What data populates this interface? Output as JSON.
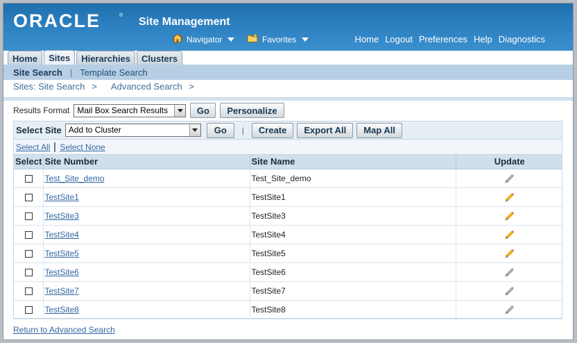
{
  "header": {
    "logo_text": "ORACLE",
    "logo_reg": "®",
    "app_title": "Site Management",
    "navigator_label": "Navigator",
    "favorites_label": "Favorites",
    "global_links": [
      "Home",
      "Logout",
      "Preferences",
      "Help",
      "Diagnostics"
    ]
  },
  "tabs": [
    {
      "label": "Home",
      "active": false
    },
    {
      "label": "Sites",
      "active": true
    },
    {
      "label": "Hierarchies",
      "active": false
    },
    {
      "label": "Clusters",
      "active": false
    }
  ],
  "subtabs": {
    "active": "Site Search",
    "separator": "|",
    "other": "Template Search"
  },
  "breadcrumb": {
    "items": [
      "Sites: Site Search",
      "Advanced Search"
    ],
    "arrow": ">"
  },
  "results_format": {
    "label": "Results Format",
    "selected": "Mail Box Search Results",
    "go_label": "Go",
    "personalize_label": "Personalize"
  },
  "control_bar": {
    "select_site_label": "Select Site",
    "selected_action": "Add to Cluster",
    "go_label": "Go",
    "separator": "|",
    "create_label": "Create",
    "export_label": "Export All",
    "map_label": "Map All"
  },
  "select_links": {
    "select_all": "Select All",
    "select_none": "Select None"
  },
  "table": {
    "columns": [
      "Select",
      "Site Number",
      "Site Name",
      "Update"
    ],
    "rows": [
      {
        "number": "Test_Site_demo",
        "name": "Test_Site_demo",
        "updatable": false
      },
      {
        "number": "TestSite1",
        "name": "TestSite1",
        "updatable": true
      },
      {
        "number": "TestSite3",
        "name": "TestSite3",
        "updatable": true
      },
      {
        "number": "TestSite4",
        "name": "TestSite4",
        "updatable": true
      },
      {
        "number": "TestSite5",
        "name": "TestSite5",
        "updatable": true
      },
      {
        "number": "TestSite6",
        "name": "TestSite6",
        "updatable": false
      },
      {
        "number": "TestSite7",
        "name": "TestSite7",
        "updatable": false
      },
      {
        "number": "TestSite8",
        "name": "TestSite8",
        "updatable": false
      }
    ]
  },
  "footer": {
    "return_link": "Return to Advanced Search"
  },
  "colors": {
    "header_blue": "#2d80c0",
    "link_blue": "#3466a3",
    "pencil_active": "#f2b705",
    "pencil_disabled": "#b5b5b5"
  },
  "icons": {
    "navigator": "house-icon",
    "favorites": "favorites-folder-icon",
    "update": "pencil-icon"
  }
}
